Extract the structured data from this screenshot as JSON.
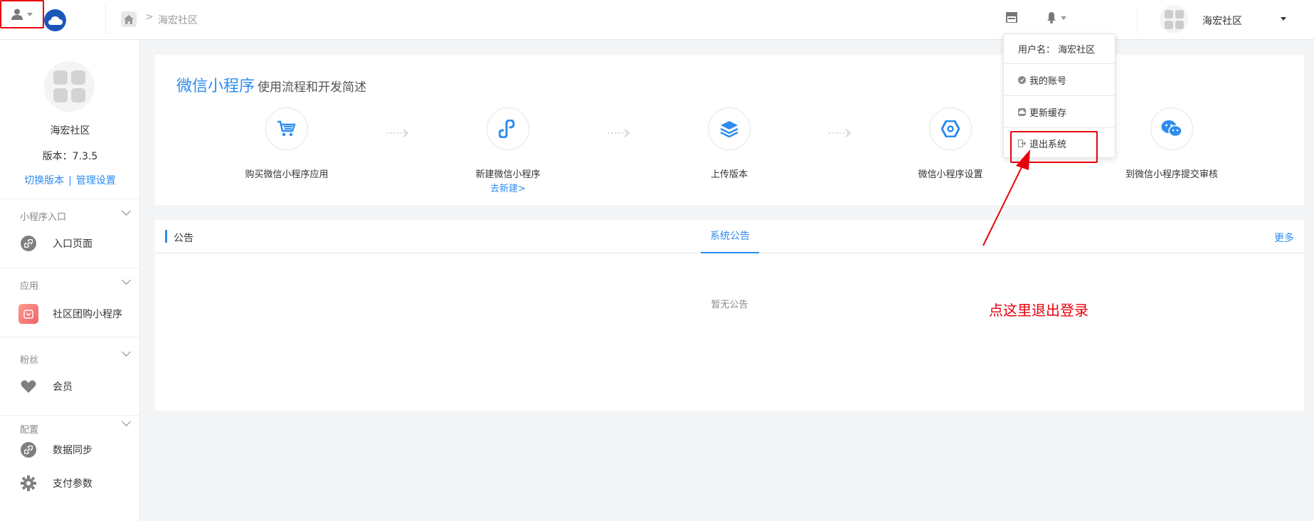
{
  "topbar": {
    "breadcrumb_separator": ">",
    "breadcrumb_current": "海宏社区",
    "user_name": "海宏社区"
  },
  "sidebar": {
    "account_name": "海宏社区",
    "version_text": "版本：7.3.5",
    "switch_version": "切换版本",
    "link_separator": "|",
    "manage_settings": "管理设置",
    "sections": [
      {
        "title": "小程序入口",
        "items": [
          {
            "label": "入口页面",
            "icon": "link-icon"
          }
        ]
      },
      {
        "title": "应用",
        "items": [
          {
            "label": "社区团购小程序",
            "icon": "app-icon"
          }
        ]
      },
      {
        "title": "粉丝",
        "items": [
          {
            "label": "会员",
            "icon": "heart-icon"
          }
        ]
      },
      {
        "title": "配置",
        "items": [
          {
            "label": "数据同步",
            "icon": "link-icon"
          },
          {
            "label": "支付参数",
            "icon": "gear-icon"
          }
        ]
      }
    ]
  },
  "workflow": {
    "title_main": "微信小程序",
    "title_sub": "使用流程和开发简述",
    "steps": [
      {
        "label": "购买微信小程序应用",
        "icon": "cart-icon"
      },
      {
        "label": "新建微信小程序",
        "sub": "去新建>",
        "icon": "link-icon"
      },
      {
        "label": "上传版本",
        "icon": "layers-icon"
      },
      {
        "label": "微信小程序设置",
        "icon": "settings-icon"
      },
      {
        "label": "到微信小程序提交审核",
        "icon": "wechat-icon"
      }
    ]
  },
  "notice": {
    "title": "公告",
    "tab": "系统公告",
    "more": "更多",
    "empty": "暂无公告"
  },
  "dropdown": {
    "username_row": "用户名：  海宏社区",
    "items": [
      {
        "label": "我的账号",
        "icon": "account-icon"
      },
      {
        "label": "更新缓存",
        "icon": "cloud-icon"
      },
      {
        "label": "退出系统",
        "icon": "logout-icon"
      }
    ]
  },
  "annotation": {
    "text": "点这里退出登录"
  },
  "colors": {
    "accent": "#2d8cf0",
    "annotation_red": "#e8000b",
    "logo_blue": "#1a56b8"
  }
}
